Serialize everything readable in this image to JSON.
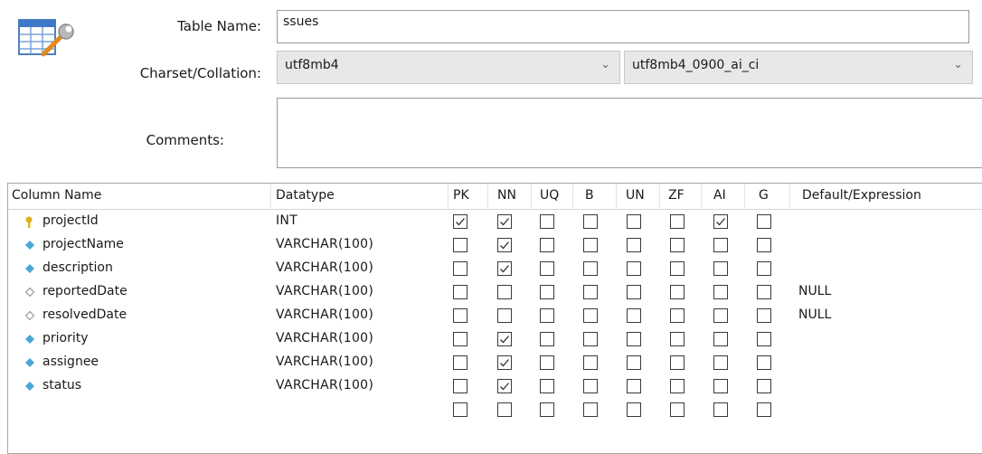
{
  "form": {
    "table_name_label": "Table Name:",
    "table_name_value": "ssues",
    "charset_label": "Charset/Collation:",
    "charset_value": "utf8mb4",
    "collation_value": "utf8mb4_0900_ai_ci",
    "comments_label": "Comments:",
    "comments_value": ""
  },
  "grid": {
    "headers": [
      "Column Name",
      "Datatype",
      "PK",
      "NN",
      "UQ",
      "B",
      "UN",
      "ZF",
      "AI",
      "G",
      "Default/Expression"
    ],
    "flag_keys": [
      "PK",
      "NN",
      "UQ",
      "B",
      "UN",
      "ZF",
      "AI",
      "G"
    ],
    "rows": [
      {
        "name": "projectId",
        "datatype": "INT",
        "default": "",
        "icon": "primary-key-icon",
        "flags": {
          "PK": true,
          "NN": true,
          "UQ": false,
          "B": false,
          "UN": false,
          "ZF": false,
          "AI": true,
          "G": false
        }
      },
      {
        "name": "projectName",
        "datatype": "VARCHAR(100)",
        "default": "",
        "icon": "column-not-null-icon",
        "flags": {
          "PK": false,
          "NN": true,
          "UQ": false,
          "B": false,
          "UN": false,
          "ZF": false,
          "AI": false,
          "G": false
        }
      },
      {
        "name": "description",
        "datatype": "VARCHAR(100)",
        "default": "",
        "icon": "column-not-null-icon",
        "flags": {
          "PK": false,
          "NN": true,
          "UQ": false,
          "B": false,
          "UN": false,
          "ZF": false,
          "AI": false,
          "G": false
        }
      },
      {
        "name": "reportedDate",
        "datatype": "VARCHAR(100)",
        "default": "NULL",
        "icon": "column-nullable-icon",
        "flags": {
          "PK": false,
          "NN": false,
          "UQ": false,
          "B": false,
          "UN": false,
          "ZF": false,
          "AI": false,
          "G": false
        }
      },
      {
        "name": "resolvedDate",
        "datatype": "VARCHAR(100)",
        "default": "NULL",
        "icon": "column-nullable-icon",
        "flags": {
          "PK": false,
          "NN": false,
          "UQ": false,
          "B": false,
          "UN": false,
          "ZF": false,
          "AI": false,
          "G": false
        }
      },
      {
        "name": "priority",
        "datatype": "VARCHAR(100)",
        "default": "",
        "icon": "column-not-null-icon",
        "flags": {
          "PK": false,
          "NN": true,
          "UQ": false,
          "B": false,
          "UN": false,
          "ZF": false,
          "AI": false,
          "G": false
        }
      },
      {
        "name": "assignee",
        "datatype": "VARCHAR(100)",
        "default": "",
        "icon": "column-not-null-icon",
        "flags": {
          "PK": false,
          "NN": true,
          "UQ": false,
          "B": false,
          "UN": false,
          "ZF": false,
          "AI": false,
          "G": false
        }
      },
      {
        "name": "status",
        "datatype": "VARCHAR(100)",
        "default": "",
        "icon": "column-not-null-icon",
        "flags": {
          "PK": false,
          "NN": true,
          "UQ": false,
          "B": false,
          "UN": false,
          "ZF": false,
          "AI": false,
          "G": false
        }
      },
      {
        "name": "",
        "datatype": "",
        "default": "",
        "icon": "",
        "flags": {
          "PK": false,
          "NN": false,
          "UQ": false,
          "B": false,
          "UN": false,
          "ZF": false,
          "AI": false,
          "G": false
        }
      }
    ]
  },
  "colors": {
    "key_icon": "#e0b21a",
    "not_null_diamond": "#4aa6d8",
    "nullable_diamond": "#9aa4ad",
    "select_bg": "#e8e8e8"
  }
}
